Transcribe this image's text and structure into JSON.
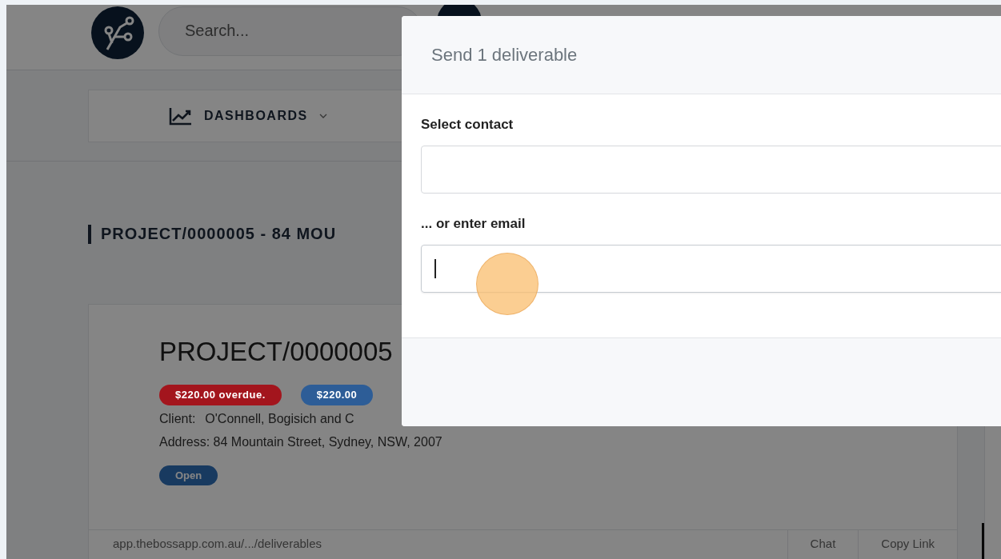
{
  "header": {
    "search": {
      "placeholder": "Search..."
    }
  },
  "nav": {
    "label": "DASHBOARDS"
  },
  "page_title": "PROJECT/0000005 - 84 MOU",
  "project_card": {
    "title": "PROJECT/0000005",
    "badges": [
      {
        "text": "$220.00 overdue.",
        "color": "#a3151d"
      },
      {
        "text": "$220.00",
        "color": "#2d5d97"
      }
    ],
    "client_label": "Client:",
    "client": "O'Connell, Bogisich and C",
    "address": "Address: 84 Mountain Street, Sydney, NSW, 2007",
    "status": "Open",
    "link": "app.thebossapp.com.au/.../deliverables",
    "actions": [
      "Chat",
      "Copy Link"
    ]
  },
  "modal": {
    "title": "Send 1 deliverable",
    "fields": [
      {
        "label": "Select contact",
        "focused": false
      },
      {
        "label": "... or enter email",
        "focused": true
      }
    ]
  }
}
